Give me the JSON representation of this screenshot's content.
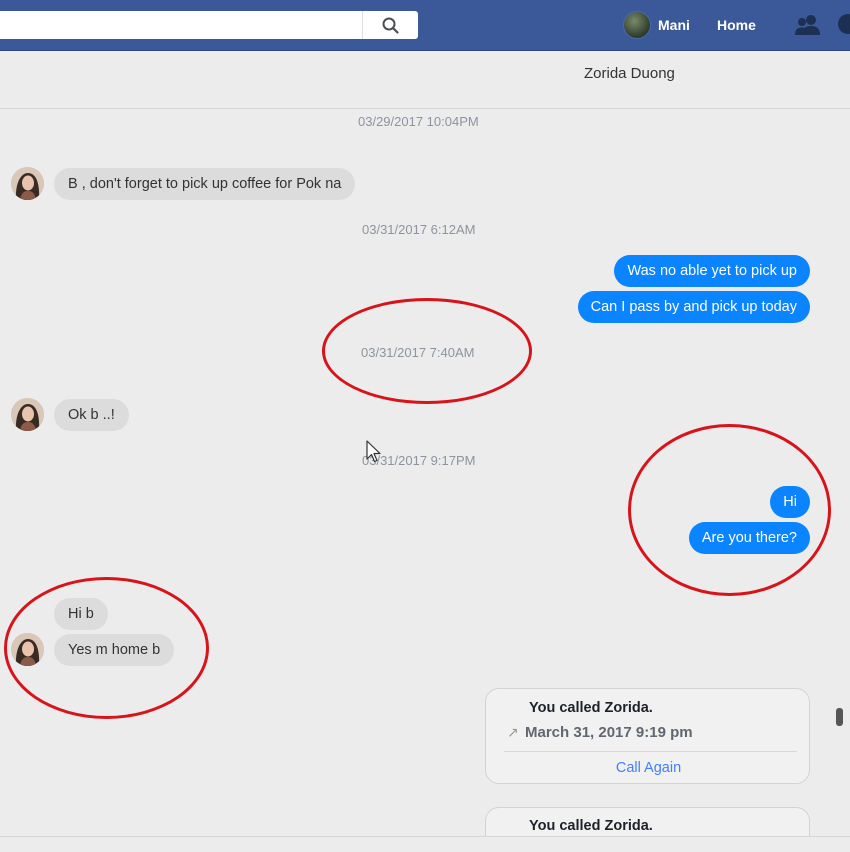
{
  "topbar": {
    "user_name": "Mani",
    "home_label": "Home"
  },
  "conversation": {
    "contact_name": "Zorida Duong"
  },
  "messages": {
    "ts1": "03/29/2017 10:04PM",
    "in1": "B , don't forget to pick up coffee for Pok na",
    "ts2": "03/31/2017 6:12AM",
    "out1": "Was no able yet to pick up",
    "out2": "Can I pass by and pick up today",
    "ts3": "03/31/2017 7:40AM",
    "in2": "Ok b ..!",
    "ts4": "03/31/2017 9:17PM",
    "out3": "Hi",
    "out4": "Are you there?",
    "in3": "Hi b",
    "in4": "Yes m home b"
  },
  "call_card_1": {
    "title": "You called Zorida.",
    "date": "March 31, 2017 9:19 pm",
    "action": "Call Again"
  },
  "call_card_2": {
    "title": "You called Zorida."
  },
  "colors": {
    "topbar": "#3b5998",
    "outgoing_bubble": "#0a84ff",
    "incoming_bubble": "#dcdcdc",
    "annotation": "#d7141a",
    "link": "#4080ff"
  }
}
